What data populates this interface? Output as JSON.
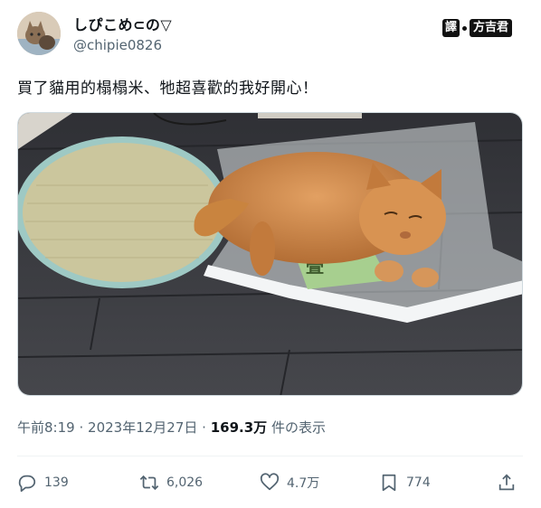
{
  "user": {
    "display_name": "しぴこめ⊂の▽",
    "handle": "@chipie0826",
    "avatar": "avatar-cat-photo"
  },
  "watermark": {
    "part1": "譯",
    "part2": "方吉君"
  },
  "tweet": {
    "text": "買了貓用的榻榻米、牠超喜歡的我好開心！",
    "media": "photo-cat-on-plastic-bag-next-to-tatami-mat",
    "media_sign_text": "畳"
  },
  "meta": {
    "time": "午前8:19",
    "sep1": "·",
    "date": "2023年12月27日",
    "sep2": "·",
    "views_count": "169.3万",
    "views_label": "件の表示"
  },
  "actions": {
    "reply": {
      "icon": "reply-icon",
      "count": "139"
    },
    "retweet": {
      "icon": "retweet-icon",
      "count": "6,026"
    },
    "like": {
      "icon": "heart-icon",
      "count": "4.7万"
    },
    "bookmark": {
      "icon": "bookmark-icon",
      "count": "774"
    },
    "share": {
      "icon": "share-icon"
    }
  },
  "colors": {
    "text": "#0f1419",
    "secondary": "#536471",
    "divider": "#eff3f4",
    "floor": "#3a3b40",
    "mat": "#c9c39b",
    "cat": "#d0894a"
  }
}
